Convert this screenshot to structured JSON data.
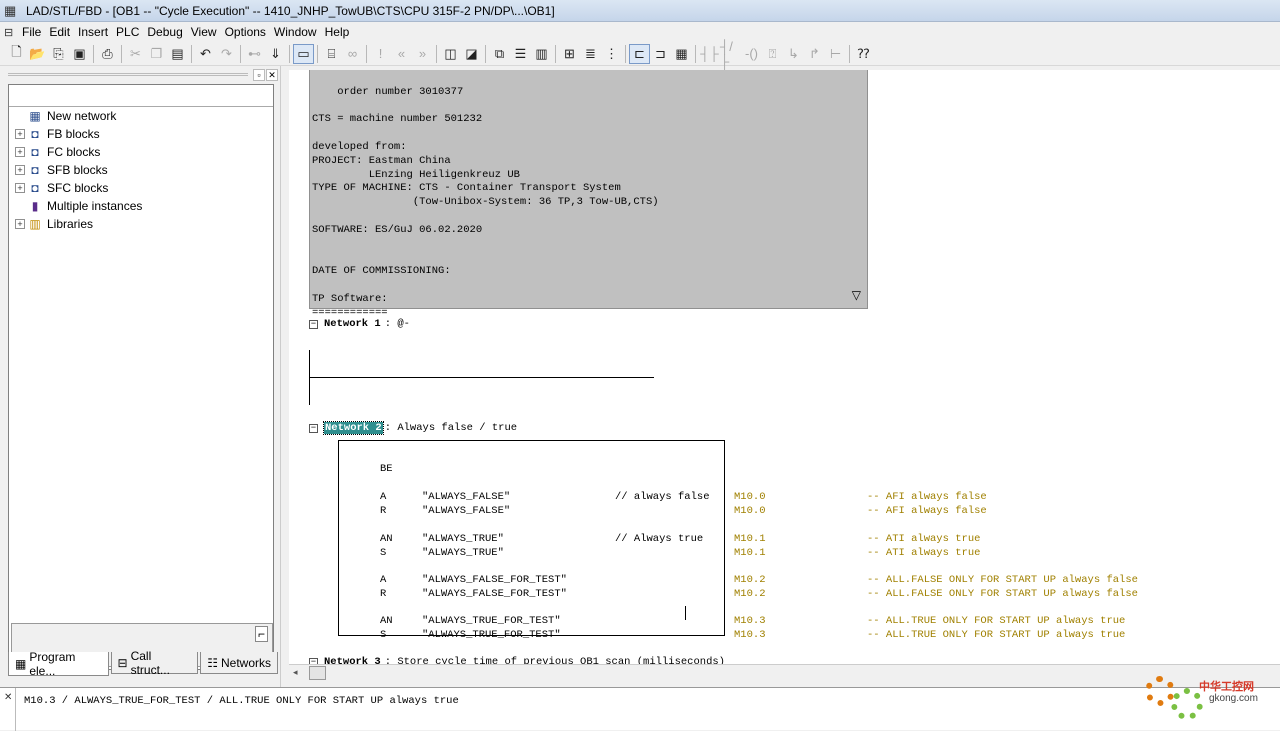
{
  "window": {
    "title": "LAD/STL/FBD  - [OB1 -- \"Cycle Execution\" -- 1410_JNHP_TowUB\\CTS\\CPU 315F-2 PN/DP\\...\\OB1]"
  },
  "menu": [
    "File",
    "Edit",
    "Insert",
    "PLC",
    "Debug",
    "View",
    "Options",
    "Window",
    "Help"
  ],
  "tree": {
    "items": [
      {
        "label": "New network",
        "expandable": false,
        "icon": "network-icon"
      },
      {
        "label": "FB blocks",
        "expandable": true,
        "icon": "block-icon"
      },
      {
        "label": "FC blocks",
        "expandable": true,
        "icon": "block-icon"
      },
      {
        "label": "SFB blocks",
        "expandable": true,
        "icon": "block-icon"
      },
      {
        "label": "SFC blocks",
        "expandable": true,
        "icon": "block-icon"
      },
      {
        "label": "Multiple instances",
        "expandable": false,
        "icon": "instances-icon"
      },
      {
        "label": "Libraries",
        "expandable": true,
        "icon": "library-icon"
      }
    ]
  },
  "tabs": [
    "Program ele...",
    "Call struct...",
    "Networks"
  ],
  "block_comment": "order number 3010377\n\nCTS = machine number 501232\n\ndeveloped from:\nPROJECT: Eastman China\n         LEnzing Heiligenkreuz UB\nTYPE OF MACHINE: CTS - Container Transport System\n                (Tow-Unibox-System: 36 TP,3 Tow-UB,CTS)\n\nSOFTWARE: ES/GuJ 06.02.2020\n\n\nDATE OF COMMISSIONING:\n\nTP Software:\n============",
  "network1": {
    "label": "Network 1",
    "title": ": @-"
  },
  "network2": {
    "label": "Network 2",
    "title": ": Always false / true",
    "lines": [
      {
        "op": "BE",
        "operand": "",
        "comment": "",
        "addr": "",
        "symcomment": ""
      },
      {
        "op": "A",
        "operand": "\"ALWAYS_FALSE\"",
        "comment": "// always false",
        "addr": "M10.0",
        "symcomment": "-- AFI always false"
      },
      {
        "op": "R",
        "operand": "\"ALWAYS_FALSE\"",
        "comment": "",
        "addr": "M10.0",
        "symcomment": "-- AFI always false"
      },
      {
        "op": "AN",
        "operand": "\"ALWAYS_TRUE\"",
        "comment": "// Always true",
        "addr": "M10.1",
        "symcomment": "-- ATI always true"
      },
      {
        "op": "S",
        "operand": "\"ALWAYS_TRUE\"",
        "comment": "",
        "addr": "M10.1",
        "symcomment": "-- ATI always true"
      },
      {
        "op": "A",
        "operand": "\"ALWAYS_FALSE_FOR_TEST\"",
        "comment": "",
        "addr": "M10.2",
        "symcomment": "-- ALL.FALSE ONLY FOR START UP always false"
      },
      {
        "op": "R",
        "operand": "\"ALWAYS_FALSE_FOR_TEST\"",
        "comment": "",
        "addr": "M10.2",
        "symcomment": "-- ALL.FALSE ONLY FOR START UP always false"
      },
      {
        "op": "AN",
        "operand": "\"ALWAYS_TRUE_FOR_TEST\"",
        "comment": "",
        "addr": "M10.3",
        "symcomment": "-- ALL.TRUE ONLY FOR START UP always true"
      },
      {
        "op": "S",
        "operand": "\"ALWAYS_TRUE_FOR_TEST\"",
        "comment": "",
        "addr": "M10.3",
        "symcomment": "-- ALL.TRUE ONLY FOR START UP always true"
      }
    ]
  },
  "network3": {
    "label": "Network 3",
    "title": ": Store cycle time of previous OB1 scan (milliseconds)"
  },
  "status": {
    "text": "M10.3 / ALWAYS_TRUE_FOR_TEST / ALL.TRUE ONLY FOR START UP always true"
  },
  "watermark": {
    "cn": "中华工控网",
    "url": "gkong.com"
  }
}
